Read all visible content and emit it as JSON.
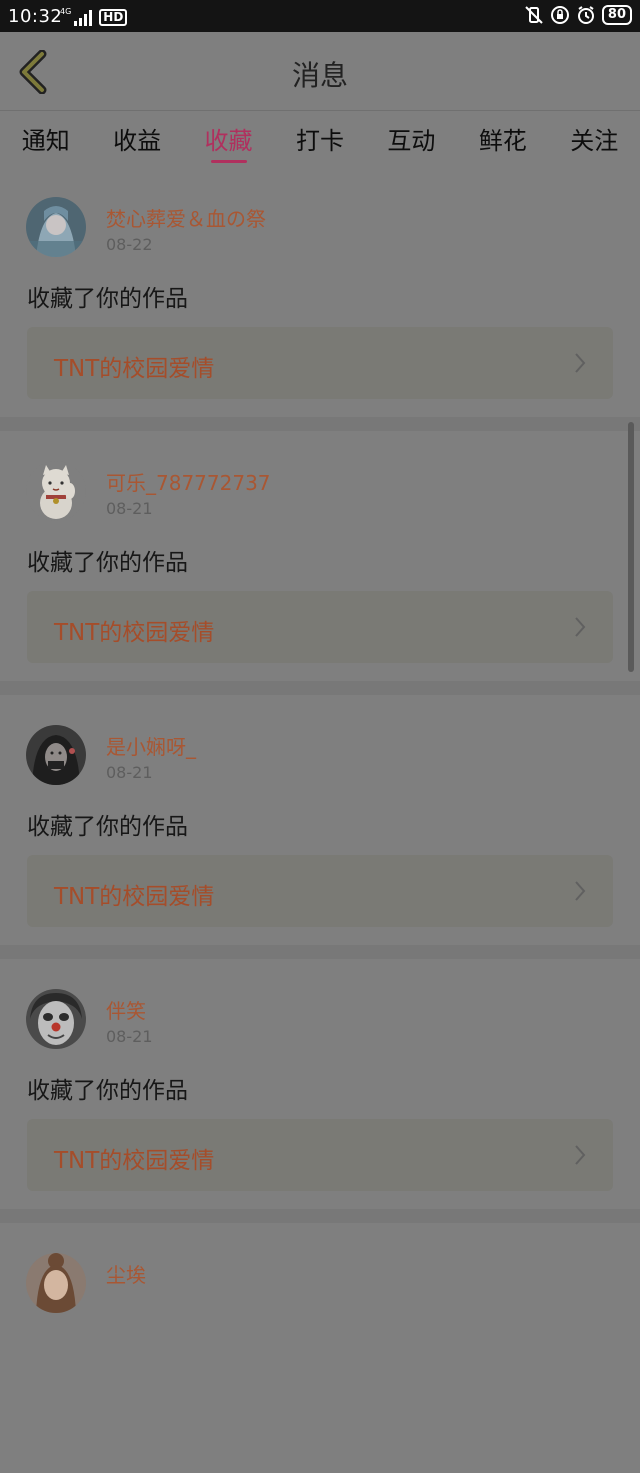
{
  "status_bar": {
    "time": "10:32",
    "network": "4G",
    "hd": "HD",
    "battery": "80"
  },
  "header": {
    "title": "消息",
    "back_icon": "chevron-left-icon"
  },
  "tabs": [
    {
      "label": "通知",
      "active": false
    },
    {
      "label": "收益",
      "active": false
    },
    {
      "label": "收藏",
      "active": true
    },
    {
      "label": "打卡",
      "active": false
    },
    {
      "label": "互动",
      "active": false
    },
    {
      "label": "鲜花",
      "active": false
    },
    {
      "label": "关注",
      "active": false
    }
  ],
  "feed": [
    {
      "user": "焚心葬爱＆血の祭",
      "date": "08-22",
      "action": "收藏了你的作品",
      "work_title": "TNT的校园爱情",
      "avatar": "anime-girl-avatar"
    },
    {
      "user": "可乐_787772737",
      "date": "08-21",
      "action": "收藏了你的作品",
      "work_title": "TNT的校园爱情",
      "avatar": "lucky-cat-avatar"
    },
    {
      "user": "是小娴呀_",
      "date": "08-21",
      "action": "收藏了你的作品",
      "work_title": "TNT的校园爱情",
      "avatar": "girl-photo-avatar"
    },
    {
      "user": "伴笑",
      "date": "08-21",
      "action": "收藏了你的作品",
      "work_title": "TNT的校园爱情",
      "avatar": "clown-avatar"
    },
    {
      "user": "尘埃",
      "date": "",
      "action": "",
      "work_title": "",
      "avatar": "girl-avatar"
    }
  ],
  "colors": {
    "accent": "#b0305e",
    "username": "#a95733",
    "work_title": "#a54d2a",
    "overlay_bg": "#7f7f7f"
  }
}
